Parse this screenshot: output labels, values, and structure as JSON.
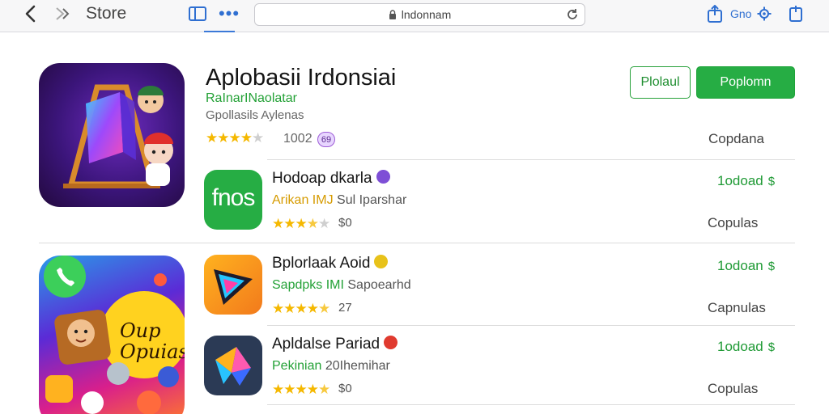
{
  "toolbar": {
    "store_label": "Store",
    "url": "lndonnam",
    "profile_label": "Gno"
  },
  "hero": {
    "title": "Aplobasii Irdonsiai",
    "subtitle": "RaInarINaolatar",
    "category": "Gpollasils Aylenas",
    "rating_count": "1002",
    "badge": "69",
    "rating": 4,
    "secondary_button": "Plolaul",
    "primary_button": "Poplomn",
    "side_label": "Copdana"
  },
  "promo": {
    "text": "Oup Opuias"
  },
  "apps": [
    {
      "title": "Hodoap dkarla",
      "subtitle_highlight": "Arikan IMJ",
      "subtitle_rest": " Sul Iparshar",
      "price": "$0",
      "rating": 3.5,
      "action": "1odoad",
      "side_label": "Copulas",
      "icon_text": "fnos",
      "badge_color": "#7e4fd6",
      "accent": "#26ad44"
    },
    {
      "title": "Bplorlaak Aoid",
      "subtitle_highlight": "Sapdpks IMI",
      "subtitle_rest": " Sapoearhd",
      "price": "27",
      "rating": 4.5,
      "action": "1odoan",
      "side_label": "Capnulas",
      "badge_color": "#e8c21a",
      "accent": "#f29a1c"
    },
    {
      "title": "Apldalse Pariad",
      "subtitle_highlight": "Pekinian",
      "subtitle_rest": " 20Ihemihar",
      "price": "$0",
      "rating": 4.5,
      "action": "1odoad",
      "side_label": "Copulas",
      "badge_color": "#e03a2f",
      "accent": "#2b3a55"
    }
  ]
}
